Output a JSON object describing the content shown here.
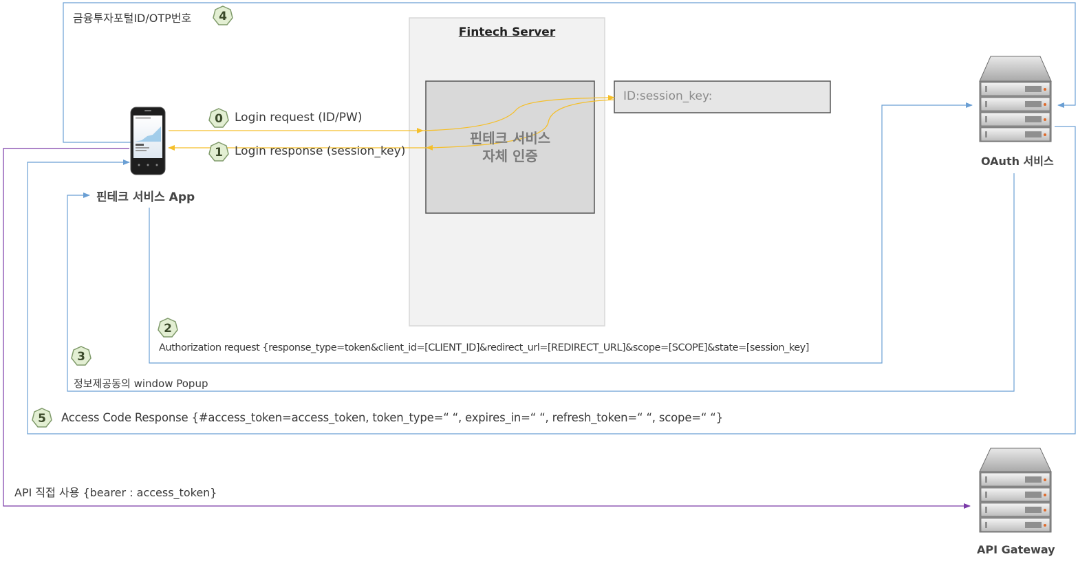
{
  "server": {
    "title": "Fintech Server",
    "auth_label_line1": "핀테크 서비스",
    "auth_label_line2": "자체 인증",
    "session_store": "ID:session_key:"
  },
  "app": {
    "label": "핀테크 서비스 App"
  },
  "oauth": {
    "label": "OAuth 서비스"
  },
  "gateway": {
    "label": "API Gateway"
  },
  "steps": [
    {
      "num": "0",
      "text": "Login request (ID/PW)"
    },
    {
      "num": "1",
      "text": "Login response (session_key)"
    },
    {
      "num": "2",
      "text": "Authorization request {response_type=token&client_id=[CLIENT_ID]&redirect_url=[REDIRECT_URL]&scope=[SCOPE]&state=[session_key]"
    },
    {
      "num": "3",
      "text": "정보제공동의 window Popup"
    },
    {
      "num": "4",
      "text": "금융투자포털ID/OTP번호"
    },
    {
      "num": "5",
      "text": "Access Code Response {#access_token=access_token, token_type=“ “, expires_in=“ “, refresh_token=“ “, scope=“ “}"
    }
  ],
  "api_usage": {
    "text": "API 직접 사용 {bearer : access_token}"
  },
  "colors": {
    "login_flow": "#f5bf2a",
    "oauth_flow": "#6a9fd4",
    "api_flow": "#8a4aa8",
    "badge_fill": "#e3efd3",
    "badge_stroke": "#7f9a6a"
  }
}
